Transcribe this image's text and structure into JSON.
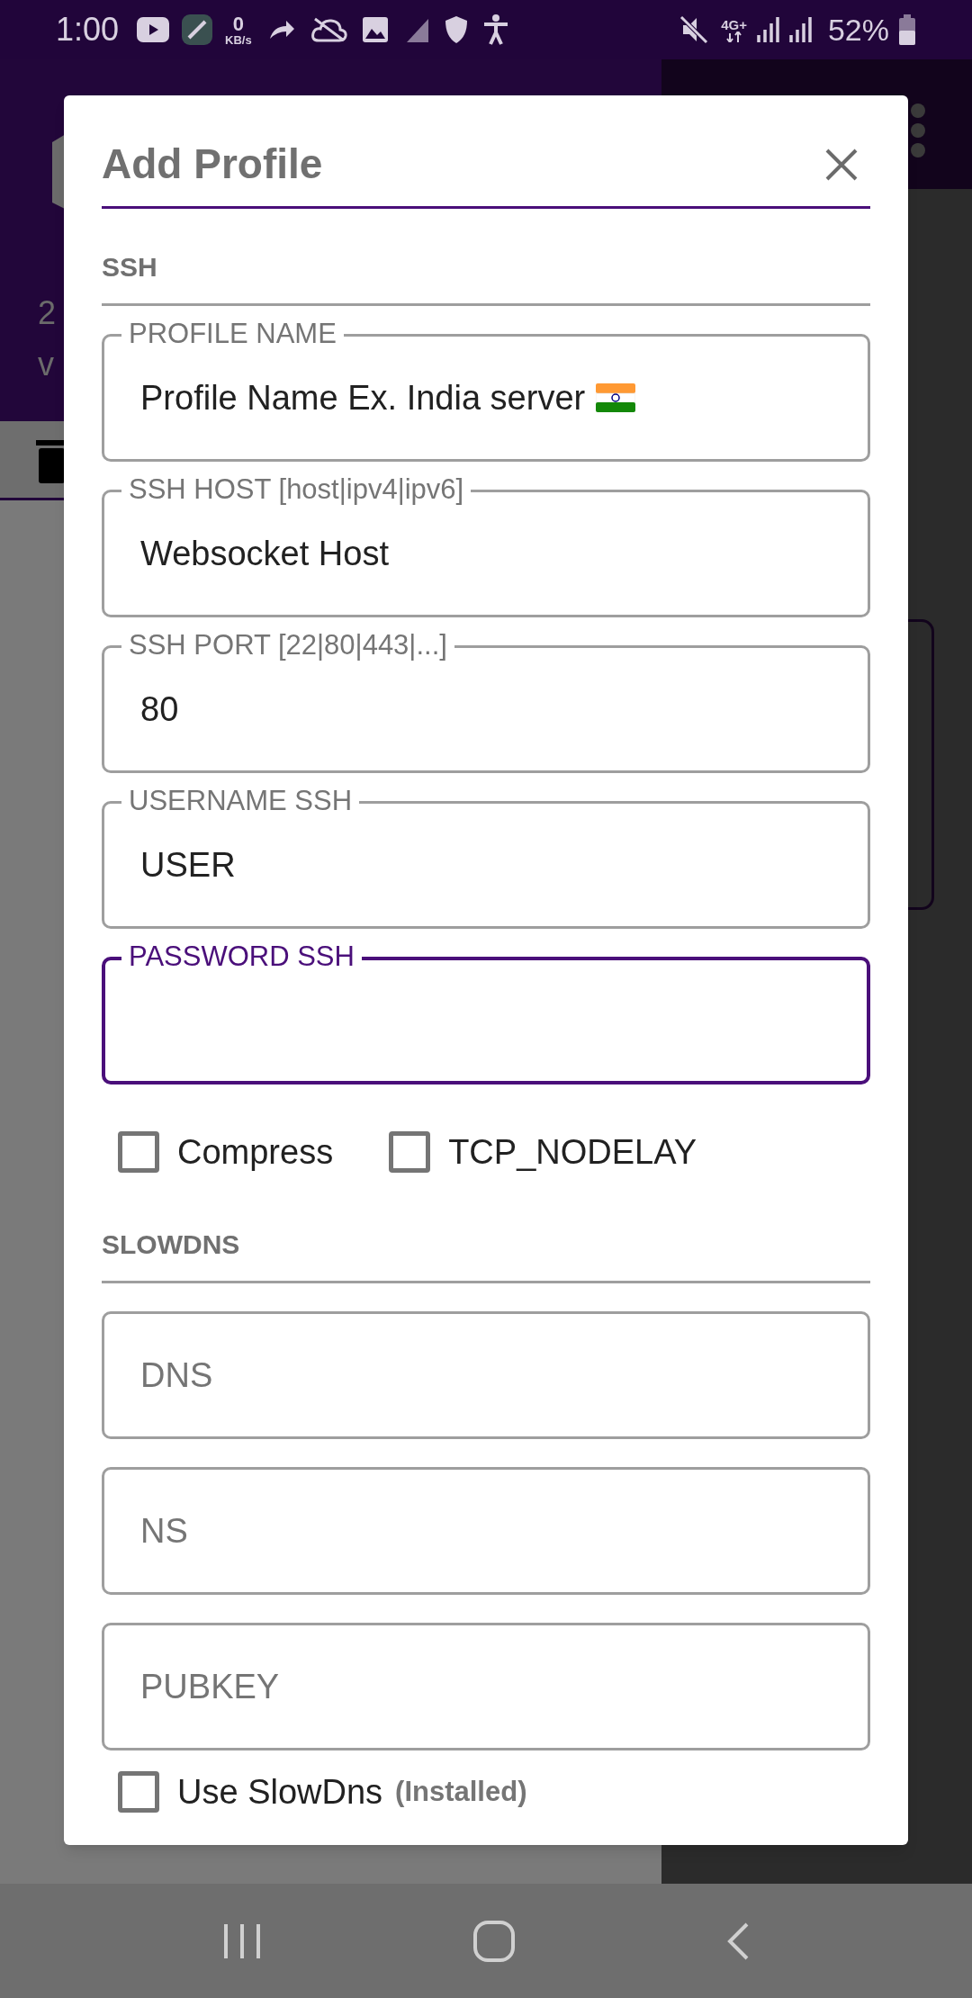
{
  "status_bar": {
    "time": "1:00",
    "speed_value": "0",
    "speed_unit": "KB/s",
    "network": "4G+",
    "battery": "52%"
  },
  "background": {
    "texts": [
      "2",
      "v"
    ]
  },
  "dialog": {
    "title": "Add Profile",
    "sections": [
      {
        "title": "SSH",
        "fields": [
          {
            "label": "PROFILE NAME",
            "value": "Profile Name Ex. India server",
            "flag": true,
            "focused": false
          },
          {
            "label": "SSH HOST [host|ipv4|ipv6]",
            "value": "Websocket Host",
            "focused": false
          },
          {
            "label": "SSH PORT [22|80|443|...]",
            "value": "80",
            "focused": false
          },
          {
            "label": "USERNAME SSH",
            "value": "USER",
            "focused": false
          },
          {
            "label": "PASSWORD SSH",
            "focused": true
          }
        ],
        "checkboxes": [
          {
            "label": "Compress",
            "checked": false
          },
          {
            "label": "TCP_NODELAY",
            "checked": false
          }
        ]
      },
      {
        "title": "SLOWDNS",
        "fields": [
          {
            "placeholder": "DNS",
            "focused": false
          },
          {
            "placeholder": "NS",
            "focused": false
          },
          {
            "placeholder": "PUBKEY",
            "focused": false
          }
        ],
        "checkboxes": [
          {
            "label": "Use SlowDns",
            "note": "(Installed)",
            "checked": false
          }
        ]
      }
    ]
  }
}
